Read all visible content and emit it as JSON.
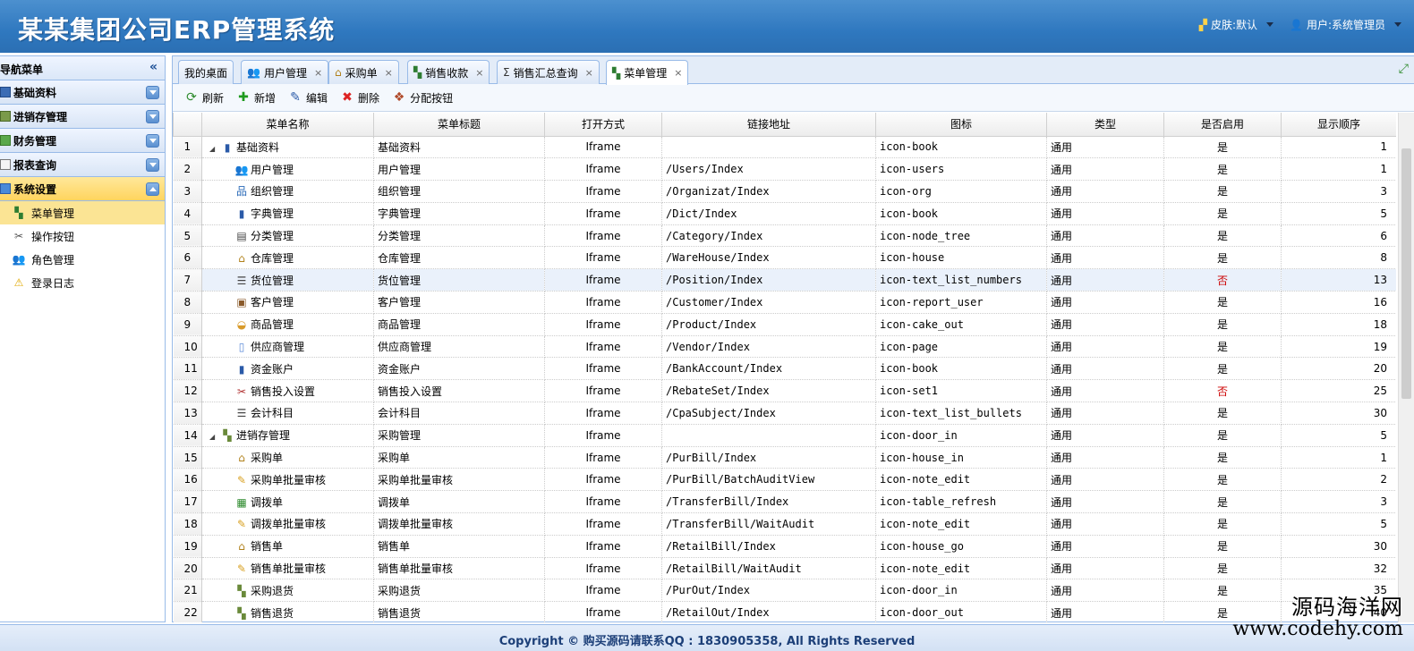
{
  "header": {
    "title": "某某集团公司ERP管理系统",
    "skin_label": "皮肤:默认",
    "user_label": "用户:系统管理员"
  },
  "sidebar": {
    "title": "导航菜单",
    "sections": [
      {
        "label": "基础资料"
      },
      {
        "label": "进销存管理"
      },
      {
        "label": "财务管理"
      },
      {
        "label": "报表查询"
      },
      {
        "label": "系统设置"
      }
    ],
    "items": [
      {
        "label": "菜单管理",
        "icon": "tree-icon"
      },
      {
        "label": "操作按钮",
        "icon": "tools-icon"
      },
      {
        "label": "角色管理",
        "icon": "users-icon"
      },
      {
        "label": "登录日志",
        "icon": "warning-icon"
      }
    ]
  },
  "tabs": [
    {
      "label": "我的桌面"
    },
    {
      "label": "用户管理"
    },
    {
      "label": "采购单"
    },
    {
      "label": "销售收款"
    },
    {
      "label": "销售汇总查询"
    },
    {
      "label": "菜单管理"
    }
  ],
  "toolbar": {
    "refresh": "刷新",
    "add": "新增",
    "edit": "编辑",
    "delete": "删除",
    "assign": "分配按钮"
  },
  "grid": {
    "columns": [
      "菜单名称",
      "菜单标题",
      "打开方式",
      "链接地址",
      "图标",
      "类型",
      "是否启用",
      "显示顺序"
    ],
    "rows": [
      {
        "no": "1",
        "name": "基础资料",
        "title": "基础资料",
        "open": "Iframe",
        "url": "",
        "icon": "icon-book",
        "type": "通用",
        "enabled": "是",
        "order": "1"
      },
      {
        "no": "2",
        "name": "用户管理",
        "title": "用户管理",
        "open": "Iframe",
        "url": "/Users/Index",
        "icon": "icon-users",
        "type": "通用",
        "enabled": "是",
        "order": "1"
      },
      {
        "no": "3",
        "name": "组织管理",
        "title": "组织管理",
        "open": "Iframe",
        "url": "/Organizat/Index",
        "icon": "icon-org",
        "type": "通用",
        "enabled": "是",
        "order": "3"
      },
      {
        "no": "4",
        "name": "字典管理",
        "title": "字典管理",
        "open": "Iframe",
        "url": "/Dict/Index",
        "icon": "icon-book",
        "type": "通用",
        "enabled": "是",
        "order": "5"
      },
      {
        "no": "5",
        "name": "分类管理",
        "title": "分类管理",
        "open": "Iframe",
        "url": "/Category/Index",
        "icon": "icon-node_tree",
        "type": "通用",
        "enabled": "是",
        "order": "6"
      },
      {
        "no": "6",
        "name": "仓库管理",
        "title": "仓库管理",
        "open": "Iframe",
        "url": "/WareHouse/Index",
        "icon": "icon-house",
        "type": "通用",
        "enabled": "是",
        "order": "8"
      },
      {
        "no": "7",
        "name": "货位管理",
        "title": "货位管理",
        "open": "Iframe",
        "url": "/Position/Index",
        "icon": "icon-text_list_numbers",
        "type": "通用",
        "enabled": "否",
        "order": "13"
      },
      {
        "no": "8",
        "name": "客户管理",
        "title": "客户管理",
        "open": "Iframe",
        "url": "/Customer/Index",
        "icon": "icon-report_user",
        "type": "通用",
        "enabled": "是",
        "order": "16"
      },
      {
        "no": "9",
        "name": "商品管理",
        "title": "商品管理",
        "open": "Iframe",
        "url": "/Product/Index",
        "icon": "icon-cake_out",
        "type": "通用",
        "enabled": "是",
        "order": "18"
      },
      {
        "no": "10",
        "name": "供应商管理",
        "title": "供应商管理",
        "open": "Iframe",
        "url": "/Vendor/Index",
        "icon": "icon-page",
        "type": "通用",
        "enabled": "是",
        "order": "19"
      },
      {
        "no": "11",
        "name": "资金账户",
        "title": "资金账户",
        "open": "Iframe",
        "url": "/BankAccount/Index",
        "icon": "icon-book",
        "type": "通用",
        "enabled": "是",
        "order": "20"
      },
      {
        "no": "12",
        "name": "销售投入设置",
        "title": "销售投入设置",
        "open": "Iframe",
        "url": "/RebateSet/Index",
        "icon": "icon-set1",
        "type": "通用",
        "enabled": "否",
        "order": "25"
      },
      {
        "no": "13",
        "name": "会计科目",
        "title": "会计科目",
        "open": "Iframe",
        "url": "/CpaSubject/Index",
        "icon": "icon-text_list_bullets",
        "type": "通用",
        "enabled": "是",
        "order": "30"
      },
      {
        "no": "14",
        "name": "进销存管理",
        "title": "采购管理",
        "open": "Iframe",
        "url": "",
        "icon": "icon-door_in",
        "type": "通用",
        "enabled": "是",
        "order": "5"
      },
      {
        "no": "15",
        "name": "采购单",
        "title": "采购单",
        "open": "Iframe",
        "url": "/PurBill/Index",
        "icon": "icon-house_in",
        "type": "通用",
        "enabled": "是",
        "order": "1"
      },
      {
        "no": "16",
        "name": "采购单批量审核",
        "title": "采购单批量审核",
        "open": "Iframe",
        "url": "/PurBill/BatchAuditView",
        "icon": "icon-note_edit",
        "type": "通用",
        "enabled": "是",
        "order": "2"
      },
      {
        "no": "17",
        "name": "调拨单",
        "title": "调拨单",
        "open": "Iframe",
        "url": "/TransferBill/Index",
        "icon": "icon-table_refresh",
        "type": "通用",
        "enabled": "是",
        "order": "3"
      },
      {
        "no": "18",
        "name": "调拨单批量审核",
        "title": "调拨单批量审核",
        "open": "Iframe",
        "url": "/TransferBill/WaitAudit",
        "icon": "icon-note_edit",
        "type": "通用",
        "enabled": "是",
        "order": "5"
      },
      {
        "no": "19",
        "name": "销售单",
        "title": "销售单",
        "open": "Iframe",
        "url": "/RetailBill/Index",
        "icon": "icon-house_go",
        "type": "通用",
        "enabled": "是",
        "order": "30"
      },
      {
        "no": "20",
        "name": "销售单批量审核",
        "title": "销售单批量审核",
        "open": "Iframe",
        "url": "/RetailBill/WaitAudit",
        "icon": "icon-note_edit",
        "type": "通用",
        "enabled": "是",
        "order": "32"
      },
      {
        "no": "21",
        "name": "采购退货",
        "title": "采购退货",
        "open": "Iframe",
        "url": "/PurOut/Index",
        "icon": "icon-door_in",
        "type": "通用",
        "enabled": "是",
        "order": "35"
      },
      {
        "no": "22",
        "name": "销售退货",
        "title": "销售退货",
        "open": "Iframe",
        "url": "/RetailOut/Index",
        "icon": "icon-door_out",
        "type": "通用",
        "enabled": "是",
        "order": "40"
      }
    ]
  },
  "footer": {
    "copyright": "Copyright © 购买源码请联系QQ : 1830905358, All Rights Reserved"
  },
  "watermark": {
    "line1": "源码海洋网",
    "line2": "www.codehy.com"
  }
}
